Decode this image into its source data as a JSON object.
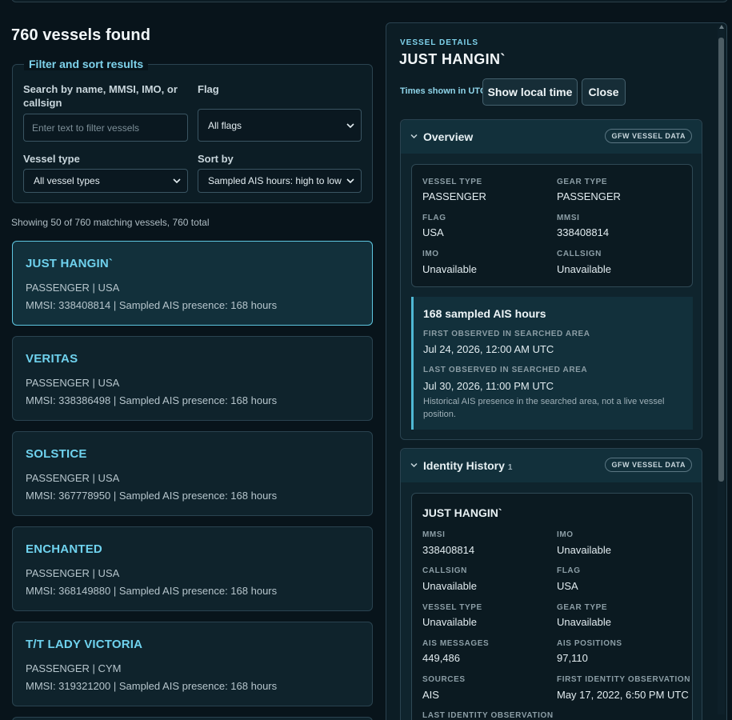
{
  "results": {
    "title": "760 vessels found",
    "showing": "Showing 50 of 760 matching vessels, 760 total"
  },
  "filters": {
    "legend": "Filter and sort results",
    "search_label": "Search by name, MMSI, IMO, or callsign",
    "search_placeholder": "Enter text to filter vessels",
    "search_value": "",
    "flag_label": "Flag",
    "flag_value": "All flags",
    "vessel_type_label": "Vessel type",
    "vessel_type_value": "All vessel types",
    "sort_label": "Sort by",
    "sort_value": "Sampled AIS hours: high to low"
  },
  "vessels": [
    {
      "name": "JUST HANGIN`",
      "sub": "PASSENGER | USA",
      "meta": "MMSI: 338408814 | Sampled AIS presence: 168 hours"
    },
    {
      "name": "VERITAS",
      "sub": "PASSENGER | USA",
      "meta": "MMSI: 338386498 | Sampled AIS presence: 168 hours"
    },
    {
      "name": "SOLSTICE",
      "sub": "PASSENGER | USA",
      "meta": "MMSI: 367778950 | Sampled AIS presence: 168 hours"
    },
    {
      "name": "ENCHANTED",
      "sub": "PASSENGER | USA",
      "meta": "MMSI: 368149880 | Sampled AIS presence: 168 hours"
    },
    {
      "name": "T/T LADY VICTORIA",
      "sub": "PASSENGER | CYM",
      "meta": "MMSI: 319321200 | Sampled AIS presence: 168 hours"
    }
  ],
  "details": {
    "eyebrow": "VESSEL DETAILS",
    "title": "JUST HANGIN`",
    "times_note": "Times shown in UTC",
    "local_time_label": "Show local time",
    "close_label": "Close",
    "overview": {
      "title": "Overview",
      "badge": "GFW VESSEL DATA",
      "vessel_type_key": "VESSEL TYPE",
      "vessel_type": "PASSENGER",
      "gear_type_key": "GEAR TYPE",
      "gear_type": "PASSENGER",
      "flag_key": "FLAG",
      "flag": "USA",
      "mmsi_key": "MMSI",
      "mmsi": "338408814",
      "imo_key": "IMO",
      "imo": "Unavailable",
      "callsign_key": "CALLSIGN",
      "callsign": "Unavailable",
      "ais_hours": "168 sampled AIS hours",
      "first_key": "FIRST OBSERVED IN SEARCHED AREA",
      "first": "Jul 24, 2026, 12:00 AM UTC",
      "last_key": "LAST OBSERVED IN SEARCHED AREA",
      "last": "Jul 30, 2026, 11:00 PM UTC",
      "note": "Historical AIS presence in the searched area, not a live vessel position."
    },
    "identity": {
      "title": "Identity History",
      "count": "1",
      "badge": "GFW VESSEL DATA",
      "name": "JUST HANGIN`",
      "mmsi_key": "MMSI",
      "mmsi": "338408814",
      "imo_key": "IMO",
      "imo": "Unavailable",
      "callsign_key": "CALLSIGN",
      "callsign": "Unavailable",
      "flag_key": "FLAG",
      "flag": "USA",
      "vessel_type_key": "VESSEL TYPE",
      "vessel_type": "Unavailable",
      "gear_type_key": "GEAR TYPE",
      "gear_type": "Unavailable",
      "ais_messages_key": "AIS MESSAGES",
      "ais_messages": "449,486",
      "ais_positions_key": "AIS POSITIONS",
      "ais_positions": "97,110",
      "sources_key": "SOURCES",
      "sources": "AIS",
      "first_identity_key": "FIRST IDENTITY OBSERVATION",
      "first_identity": "May 17, 2022, 6:50 PM UTC",
      "last_identity_key": "LAST IDENTITY OBSERVATION"
    }
  },
  "colors": {
    "accent": "#6fd2ee",
    "background": "#08141b",
    "card": "#0f232c",
    "active_border": "#5ec6e0"
  }
}
